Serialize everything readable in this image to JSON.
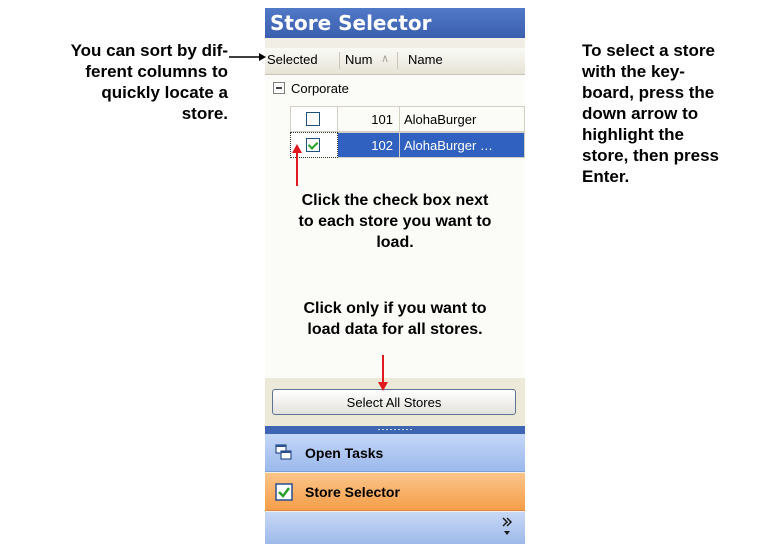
{
  "callouts": {
    "sort": "You can sort by dif-\nferent columns to\nquickly locate a\nstore.",
    "keyboard": "To select a store\nwith the key-\nboard, press the\ndown arrow to\nhighlight the\nstore, then press\nEnter."
  },
  "panel": {
    "title": "Store Selector",
    "columns": {
      "selected": "Selected",
      "num": "Num",
      "sort_indicator": "∧",
      "name": "Name"
    },
    "group": {
      "label": "Corporate",
      "expander": "minus-square-icon"
    },
    "stores": [
      {
        "checked": false,
        "num": "101",
        "name": "AlohaBurger",
        "highlighted": false
      },
      {
        "checked": true,
        "num": "102",
        "name": "AlohaBurger …",
        "highlighted": true
      }
    ],
    "instructions": {
      "check_box": "Click the check box next\nto each store you want to\nload.",
      "select_all": "Click only if you want to\nload data for all stores."
    },
    "select_all_button": "Select All Stores"
  },
  "nav": {
    "open_tasks": {
      "label": "Open Tasks",
      "icon": "windows-icon"
    },
    "store_selector": {
      "label": "Store Selector",
      "icon": "checkbox-icon"
    },
    "overflow_icon": "chevron-double-down-icon"
  },
  "colors": {
    "header_blue": "#4a6fbe",
    "selection_blue": "#3161c0",
    "active_orange": "#f7a85a",
    "arrow_red": "#e0191e"
  }
}
